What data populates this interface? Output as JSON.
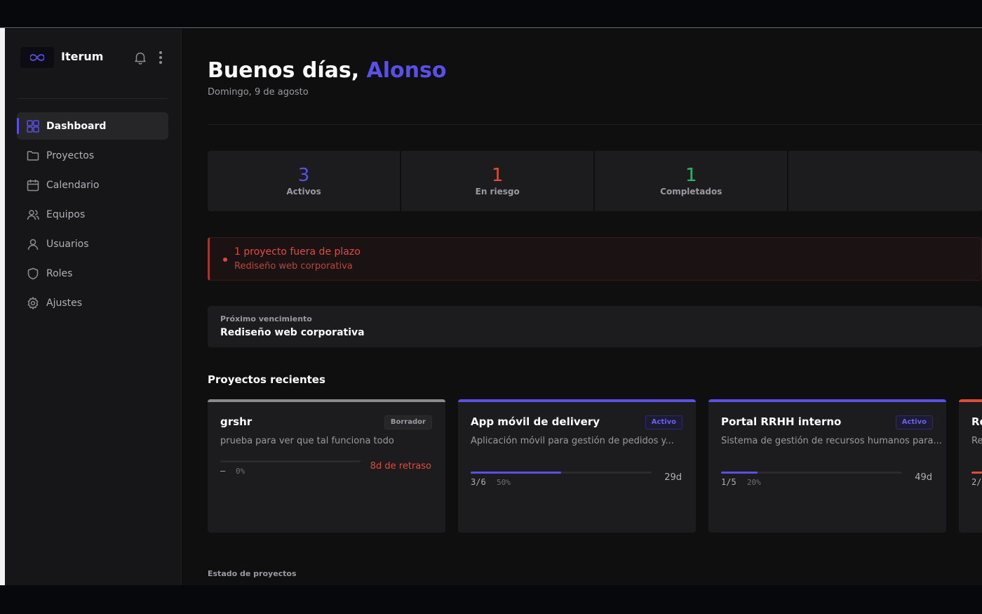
{
  "app": {
    "name": "Iterum"
  },
  "sidebar": {
    "items": [
      {
        "label": "Dashboard",
        "icon": "grid-icon",
        "active": true
      },
      {
        "label": "Proyectos",
        "icon": "folder-icon"
      },
      {
        "label": "Calendario",
        "icon": "calendar-icon"
      },
      {
        "label": "Equipos",
        "icon": "users-icon"
      },
      {
        "label": "Usuarios",
        "icon": "user-icon"
      },
      {
        "label": "Roles",
        "icon": "shield-icon"
      },
      {
        "label": "Ajustes",
        "icon": "gear-icon"
      }
    ]
  },
  "header": {
    "greeting": "Buenos días,",
    "user_name": "Alonso",
    "date": "Domingo, 9 de agosto"
  },
  "stats": [
    {
      "value": "3",
      "label": "Activos",
      "color": "#5b50e6"
    },
    {
      "value": "1",
      "label": "En riesgo",
      "color": "#e24a3c"
    },
    {
      "value": "1",
      "label": "Completados",
      "color": "#2fb36b"
    }
  ],
  "alert": {
    "title": "1 proyecto fuera de plazo",
    "subtitle": "Rediseño web corporativa"
  },
  "next_due": {
    "label": "Próximo vencimiento",
    "value": "Rediseño web corporativa"
  },
  "recent": {
    "title": "Proyectos recientes",
    "projects": [
      {
        "title": "grshr",
        "status": "Borrador",
        "description": "prueba para ver que tal funciona todo",
        "count": "–",
        "percent_label": "0%",
        "progress": 0,
        "remaining": "8d de retraso",
        "overdue": true,
        "accent": "#8a8a90"
      },
      {
        "title": "App móvil de delivery",
        "status": "Activo",
        "description": "Aplicación móvil para gestión de pedidos y...",
        "count": "3/6",
        "percent_label": "50%",
        "progress": 0.5,
        "remaining": "29d",
        "overdue": false,
        "accent": "#5b50e6"
      },
      {
        "title": "Portal RRHH interno",
        "status": "Activo",
        "description": "Sistema de gestión de recursos humanos para...",
        "count": "1/5",
        "percent_label": "20%",
        "progress": 0.2,
        "remaining": "49d",
        "overdue": false,
        "accent": "#5b50e6"
      },
      {
        "title": "Re",
        "description": "Re",
        "count": "2/",
        "progress": 0.4,
        "accent": "#e24a3c"
      }
    ]
  },
  "status_section": {
    "title": "Estado de proyectos"
  }
}
